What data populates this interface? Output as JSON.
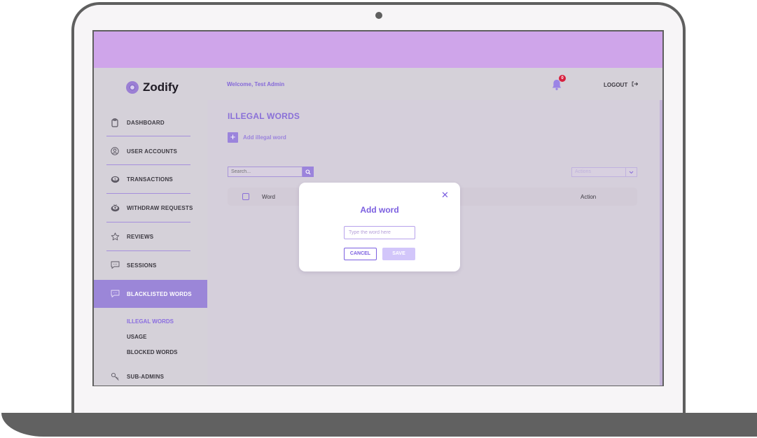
{
  "brand": {
    "name": "Zodify",
    "accent": "#9b86d8",
    "primary": "#7b5fe0"
  },
  "sidebar": {
    "items": [
      {
        "label": "DASHBOARD",
        "icon": "clipboard-icon"
      },
      {
        "label": "USER ACCOUNTS",
        "icon": "user-circle-icon"
      },
      {
        "label": "TRANSACTIONS",
        "icon": "coins-icon"
      },
      {
        "label": "WITHDRAW REQUESTS",
        "icon": "withdraw-icon"
      },
      {
        "label": "REVIEWS",
        "icon": "star-icon"
      },
      {
        "label": "SESSIONS",
        "icon": "chat-icon"
      },
      {
        "label": "BLACKLISTED WORDS",
        "icon": "chat-icon",
        "active": true
      },
      {
        "label": "SUB-ADMINS",
        "icon": "key-icon"
      }
    ],
    "submenu": [
      {
        "label": "ILLEGAL WORDS",
        "active": true
      },
      {
        "label": "USAGE"
      },
      {
        "label": "BLOCKED WORDS"
      }
    ]
  },
  "header": {
    "welcome": "Welcome, Test Admin",
    "notification_count": "0",
    "logout_label": "LOGOUT"
  },
  "main": {
    "title": "ILLEGAL WORDS",
    "add_label": "Add illegal word",
    "search_placeholder": "Search...",
    "actions_placeholder": "Actions",
    "table": {
      "columns": [
        "Word",
        "Action"
      ],
      "rows": []
    }
  },
  "modal": {
    "title": "Add word",
    "input_placeholder": "Type the word here",
    "input_value": "",
    "cancel_label": "CANCEL",
    "save_label": "SAVE"
  }
}
